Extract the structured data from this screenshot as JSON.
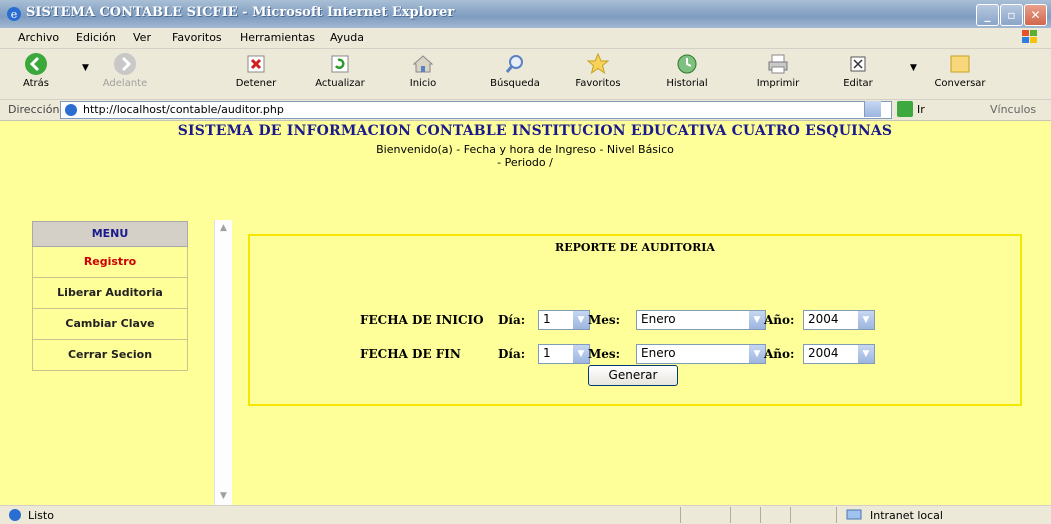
{
  "window": {
    "title": "SISTEMA CONTABLE SICFIE - Microsoft Internet Explorer"
  },
  "menubar": [
    "Archivo",
    "Edición",
    "Ver",
    "Favoritos",
    "Herramientas",
    "Ayuda"
  ],
  "toolbar": {
    "back": "Atrás",
    "forward": "Adelante",
    "stop": "Detener",
    "refresh": "Actualizar",
    "home": "Inicio",
    "search": "Búsqueda",
    "favorites": "Favoritos",
    "history": "Historial",
    "print": "Imprimir",
    "edit": "Editar",
    "discuss": "Conversar"
  },
  "address": {
    "label": "Dirección",
    "url": "http://localhost/contable/auditor.php",
    "go": "Ir",
    "links": "Vínculos"
  },
  "page": {
    "title": "SISTEMA DE INFORMACION CONTABLE INSTITUCION EDUCATIVA CUATRO ESQUINAS",
    "welcome": "Bienvenido(a) - Fecha y hora de Ingreso - Nivel Básico",
    "period": "- Periodo /"
  },
  "menu": {
    "header": "MENU",
    "items": [
      "Registro",
      "Liberar Auditoria",
      "Cambiar Clave",
      "Cerrar Secion"
    ]
  },
  "report": {
    "title": "REPORTE DE AUDITORIA",
    "start_label": "FECHA DE INICIO",
    "end_label": "FECHA DE FIN",
    "day_label": "Día:",
    "month_label": "Mes:",
    "year_label": "Año:",
    "start": {
      "day": "1",
      "month": "Enero",
      "year": "2004"
    },
    "end": {
      "day": "1",
      "month": "Enero",
      "year": "2004"
    },
    "generate": "Generar"
  },
  "status": {
    "text": "Listo",
    "zone": "Intranet local"
  }
}
